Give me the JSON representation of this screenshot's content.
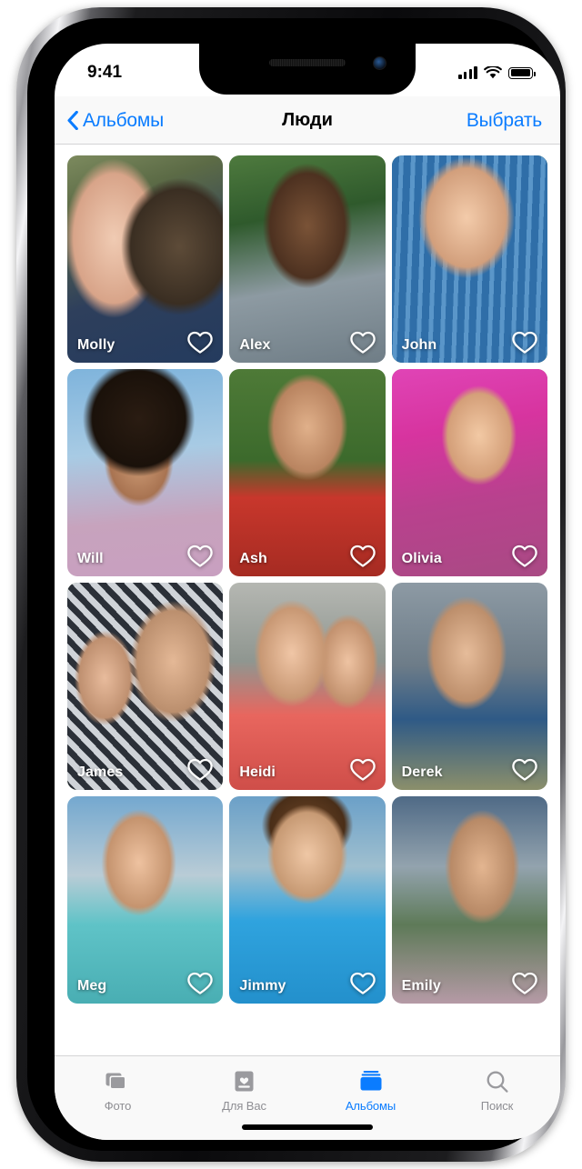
{
  "status_bar": {
    "time": "9:41",
    "signal_icon": "cellular-bars-icon",
    "wifi_icon": "wifi-icon",
    "battery_icon": "battery-full-icon"
  },
  "nav_bar": {
    "back_label": "Альбомы",
    "back_icon": "chevron-left-icon",
    "title": "Люди",
    "select_label": "Выбрать"
  },
  "colors": {
    "accent": "#0a7cff",
    "inactive": "#8e8e93",
    "bar_background": "#f9f9f9",
    "hairline": "#d4d4d6"
  },
  "people": [
    {
      "name": "Molly",
      "favorite_icon": "heart-outline-icon",
      "favorite": false,
      "photo": "woman-with-dog"
    },
    {
      "name": "Alex",
      "favorite_icon": "heart-outline-icon",
      "favorite": false,
      "photo": "man-in-forest"
    },
    {
      "name": "John",
      "favorite_icon": "heart-outline-icon",
      "favorite": false,
      "photo": "man-striped-shirt"
    },
    {
      "name": "Will",
      "favorite_icon": "heart-outline-icon",
      "favorite": false,
      "photo": "man-curly-hair"
    },
    {
      "name": "Ash",
      "favorite_icon": "heart-outline-icon",
      "favorite": false,
      "photo": "man-red-jacket"
    },
    {
      "name": "Olivia",
      "favorite_icon": "heart-outline-icon",
      "favorite": false,
      "photo": "girl-pink-jacket"
    },
    {
      "name": "James",
      "favorite_icon": "heart-outline-icon",
      "favorite": false,
      "photo": "older-man-with-girl"
    },
    {
      "name": "Heidi",
      "favorite_icon": "heart-outline-icon",
      "favorite": false,
      "photo": "woman-with-girls"
    },
    {
      "name": "Derek",
      "favorite_icon": "heart-outline-icon",
      "favorite": false,
      "photo": "man-denim-shirt"
    },
    {
      "name": "Meg",
      "favorite_icon": "heart-outline-icon",
      "favorite": false,
      "photo": "girl-teal-jacket"
    },
    {
      "name": "Jimmy",
      "favorite_icon": "heart-outline-icon",
      "favorite": false,
      "photo": "boy-blue-shirt"
    },
    {
      "name": "Emily",
      "favorite_icon": "heart-outline-icon",
      "favorite": false,
      "photo": "woman-mountains"
    }
  ],
  "tab_bar": {
    "items": [
      {
        "label": "Фото",
        "icon": "photos-stack-icon",
        "active": false
      },
      {
        "label": "Для Вас",
        "icon": "for-you-card-icon",
        "active": false
      },
      {
        "label": "Альбомы",
        "icon": "albums-folder-icon",
        "active": true
      },
      {
        "label": "Поиск",
        "icon": "search-icon",
        "active": false
      }
    ]
  }
}
